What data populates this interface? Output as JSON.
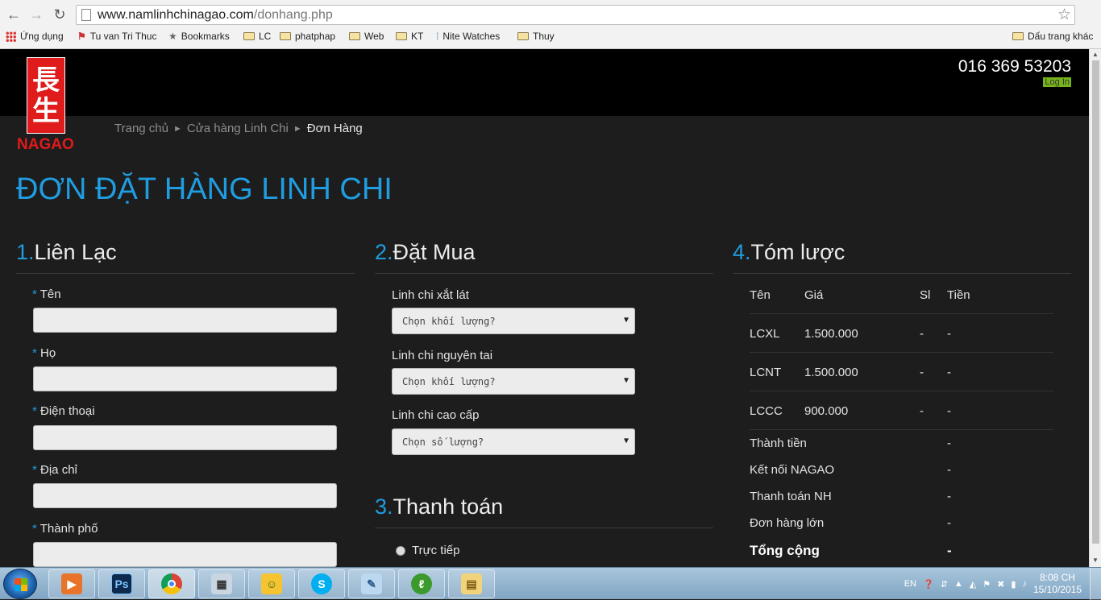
{
  "browser": {
    "url_domain": "www.namlinhchinagao.com",
    "url_path": "/donhang.php",
    "bookmarks": [
      "Ứng dụng",
      "Tu van Tri Thuc",
      "Bookmarks",
      "LC",
      "phatphap",
      "Web",
      "KT",
      "Nite Watches",
      "Thuy",
      "Dấu trang khác"
    ]
  },
  "header": {
    "phone": "016 369 53203",
    "login": "Log In",
    "logo_chars": [
      "長",
      "生"
    ],
    "logo_text": "NAGAO"
  },
  "breadcrumb": {
    "home": "Trang chủ",
    "store": "Cửa hàng Linh Chi",
    "current": "Đơn Hàng",
    "sep": "►"
  },
  "page_title": "ĐƠN ĐẶT HÀNG LINH CHI",
  "contact": {
    "num": "1.",
    "title": "Liên Lạc",
    "req": "*",
    "fields": [
      "Tên",
      "Họ",
      "Điện thoại",
      "Địa chỉ",
      "Thành phố"
    ]
  },
  "order": {
    "num": "2.",
    "title": "Đặt Mua",
    "items": [
      {
        "label": "Linh chi xắt lát",
        "placeholder": "Chọn khối lượng?"
      },
      {
        "label": "Linh chi nguyên tai",
        "placeholder": "Chọn khối lượng?"
      },
      {
        "label": "Linh chi cao cấp",
        "placeholder": "Chọn số lượng?"
      }
    ]
  },
  "payment": {
    "num": "3.",
    "title": "Thanh toán",
    "options": [
      "Trực tiếp"
    ]
  },
  "summary": {
    "num": "4.",
    "title": "Tóm lược",
    "headers": [
      "Tên",
      "Giá",
      "Sl",
      "Tiền"
    ],
    "rows": [
      {
        "name": "LCXL",
        "price": "1.500.000",
        "qty": "-",
        "amount": "-"
      },
      {
        "name": "LCNT",
        "price": "1.500.000",
        "qty": "-",
        "amount": "-"
      },
      {
        "name": "LCCC",
        "price": "900.000",
        "qty": "-",
        "amount": "-"
      }
    ],
    "totals": [
      {
        "label": "Thành tiền",
        "value": "-"
      },
      {
        "label": "Kết nối NAGAO",
        "value": "-"
      },
      {
        "label": "Thanh toán NH",
        "value": "-"
      },
      {
        "label": "Đơn hàng lớn",
        "value": "-"
      },
      {
        "label": "Tổng cộng",
        "value": "-"
      }
    ]
  },
  "taskbar": {
    "lang": "EN",
    "time": "8:08 CH",
    "date": "15/10/2015"
  },
  "colors": {
    "accent": "#1f9de0",
    "logo_red": "#e01b1b",
    "login_green": "#77b41c"
  }
}
